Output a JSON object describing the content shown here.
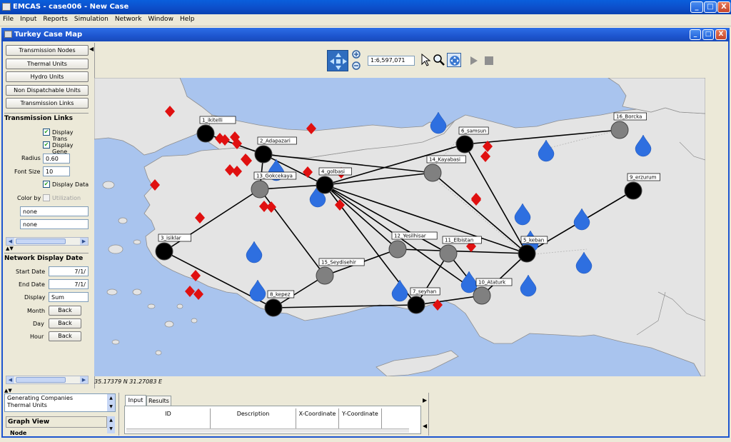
{
  "window": {
    "title": "EMCAS - case006 - New Case",
    "minimize": "_",
    "maximize": "□",
    "close": "X"
  },
  "menu": [
    "File",
    "Input",
    "Reports",
    "Simulation",
    "Network",
    "Window",
    "Help"
  ],
  "internal_frame": {
    "title": "Turkey Case Map"
  },
  "left_panel": {
    "buttons": [
      "Transmission Nodes",
      "Thermal Units",
      "Hydro Units",
      "Non Dispatchable Units",
      "Transmission Links"
    ],
    "transmission_links": {
      "heading": "Transmission Links",
      "display_trans": "Display Trans",
      "display_gene": "Display Gene",
      "radius_label": "Radius",
      "radius_value": "0.60",
      "font_size_label": "Font Size",
      "font_size_value": "10",
      "display_data": "Display Data",
      "color_by_label": "Color by",
      "utilization": "Utilization",
      "select1": "none",
      "select2": "none"
    },
    "network_date": {
      "heading": "Network Display Date",
      "start_label": "Start Date",
      "start_value": "7/1/",
      "end_label": "End Date",
      "end_value": "7/1/",
      "display_label": "Display",
      "display_value": "Sum",
      "month_label": "Month",
      "day_label": "Day",
      "hour_label": "Hour",
      "back": "Back"
    }
  },
  "toolbar": {
    "scale": "1:6,597,071"
  },
  "map": {
    "coordinates": "35.17379 N 31.27083 E",
    "nodes": [
      {
        "label": "1_ikitelli",
        "color": "black"
      },
      {
        "label": "2_Adapazari",
        "color": "black"
      },
      {
        "label": "3_isiklar",
        "color": "black"
      },
      {
        "label": "4_golbasi",
        "color": "black"
      },
      {
        "label": "5_keban",
        "color": "black"
      },
      {
        "label": "6_samsun",
        "color": "black"
      },
      {
        "label": "7_seyhan",
        "color": "black"
      },
      {
        "label": "8_kepez",
        "color": "black"
      },
      {
        "label": "9_erzurum",
        "color": "black"
      },
      {
        "label": "10_Ataturk",
        "color": "gray"
      },
      {
        "label": "11_Elbistan",
        "color": "gray"
      },
      {
        "label": "12_Yesilhisar",
        "color": "gray"
      },
      {
        "label": "13_Gokcekaya",
        "color": "gray"
      },
      {
        "label": "14_Kayabasi",
        "color": "gray"
      },
      {
        "label": "15_Seydisehir",
        "color": "gray"
      },
      {
        "label": "16_Borcka",
        "color": "gray"
      }
    ],
    "colors": {
      "sea": "#a9c4ee",
      "land": "#e4e4e4",
      "thermal": "#e01010",
      "hydro": "#2e6fe0"
    }
  },
  "bottom": {
    "list_items": [
      "Generating Companies",
      "Thermal Units"
    ],
    "graph_view": "Graph View",
    "node_item": "Node",
    "tabs": [
      "Input",
      "Results"
    ],
    "columns": [
      "ID",
      "Description",
      "X-Coordinate",
      "Y-Coordinate"
    ]
  }
}
